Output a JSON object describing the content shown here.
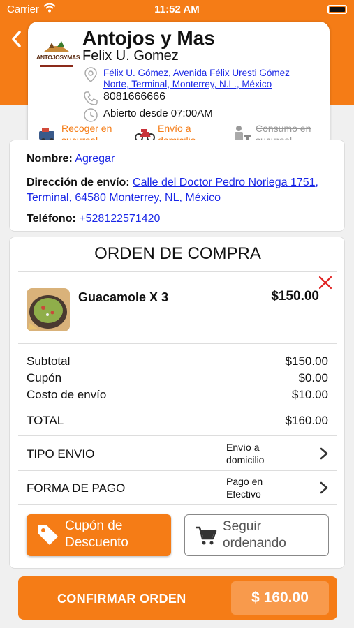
{
  "status_bar": {
    "carrier": "Carrier",
    "time": "11:52 AM"
  },
  "restaurant": {
    "logo_text": "ANTOJOSYMAS",
    "name": "Antojos y Mas",
    "owner": "Felix U. Gomez",
    "address": "Félix U. Gómez, Avenida Félix Uresti Gómez Norte, Terminal, Monterrey, N.L., México",
    "phone": "8081666666",
    "hours": "Abierto desde 07:00AM",
    "services": [
      {
        "label": "Recoger en sucursal",
        "icon": "pickup-icon",
        "enabled": true
      },
      {
        "label": "Envío a domicilio",
        "icon": "motorcycle-icon",
        "enabled": true
      },
      {
        "label": "Consumo en sucursal",
        "icon": "dine-in-icon",
        "enabled": false
      }
    ]
  },
  "customer": {
    "name_label": "Nombre:",
    "name_value": "Agregar",
    "address_label": "Dirección de envío:",
    "address_value": "Calle del Doctor Pedro Noriega 1751, Terminal, 64580 Monterrey, NL, México",
    "phone_label": "Teléfono:",
    "phone_value": "+528122571420"
  },
  "order": {
    "title": "ORDEN DE COMPRA",
    "items": [
      {
        "name": "Guacamole X 3",
        "price": "$150.00"
      }
    ],
    "summary": {
      "subtotal_label": "Subtotal",
      "subtotal": "$150.00",
      "coupon_label": "Cupón",
      "coupon": "$0.00",
      "shipping_label": "Costo de envío",
      "shipping": "$10.00",
      "total_label": "TOTAL",
      "total": "$160.00"
    },
    "shipping_type_label": "TIPO ENVIO",
    "shipping_type_value": "Envío a domicilio",
    "payment_label": "FORMA DE PAGO",
    "payment_value": "Pago en Efectivo",
    "coupon_button": "Cupón de Descuento",
    "continue_button": "Seguir ordenando"
  },
  "confirm": {
    "label": "CONFIRMAR ORDEN",
    "total": "$ 160.00"
  },
  "colors": {
    "accent": "#f57c16",
    "link": "#1a27e6",
    "remove": "#e02020"
  }
}
